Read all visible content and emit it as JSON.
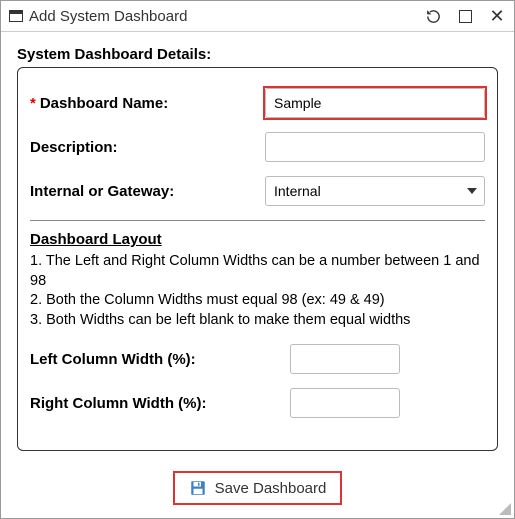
{
  "window": {
    "title": "Add System Dashboard"
  },
  "section_title": "System Dashboard Details:",
  "fields": {
    "dashboard_name": {
      "label": "Dashboard Name:",
      "value": "Sample",
      "required": true
    },
    "description": {
      "label": "Description:",
      "value": ""
    },
    "internal_or_gateway": {
      "label": "Internal or Gateway:",
      "value": "Internal"
    },
    "left_col": {
      "label": "Left Column Width (%):",
      "value": ""
    },
    "right_col": {
      "label": "Right Column Width (%):",
      "value": ""
    }
  },
  "layout": {
    "heading": "Dashboard Layout",
    "note1": "1. The Left and Right Column Widths can be a number between 1 and 98",
    "note2": "2. Both the Column Widths must equal 98 (ex: 49 & 49)",
    "note3": "3. Both Widths can be left blank to make them equal widths"
  },
  "actions": {
    "save": "Save Dashboard"
  },
  "required_marker": "*"
}
